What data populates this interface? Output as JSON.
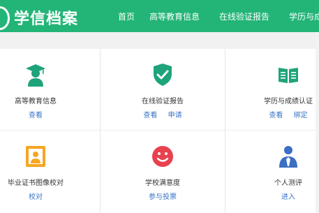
{
  "brand": {
    "name": "学信档案"
  },
  "nav": [
    {
      "label": "首页"
    },
    {
      "label": "高等教育信息"
    },
    {
      "label": "在线验证报告"
    },
    {
      "label": "学历与成"
    }
  ],
  "cards": [
    {
      "title": "高等教育信息",
      "icon": "graduate-person-icon",
      "links": [
        "查看"
      ]
    },
    {
      "title": "在线验证报告",
      "icon": "shield-check-icon",
      "links": [
        "查看",
        "申请"
      ]
    },
    {
      "title": "学历与成绩认证",
      "icon": "open-book-icon",
      "links": [
        "查看",
        "绑定"
      ]
    },
    {
      "title": "毕业证书图像校对",
      "icon": "portrait-frame-icon",
      "links": [
        "校对"
      ]
    },
    {
      "title": "学校满意度",
      "icon": "smiley-face-icon",
      "links": [
        "参与投票"
      ]
    },
    {
      "title": "个人测评",
      "icon": "person-tie-icon",
      "links": [
        "进入"
      ]
    }
  ],
  "colors": {
    "header_green": "#22b577",
    "icon_green": "#1fa37a",
    "icon_red": "#e8424f",
    "icon_orange": "#f5a623",
    "icon_blue": "#3a6fc4",
    "link_blue": "#3a74c6"
  }
}
